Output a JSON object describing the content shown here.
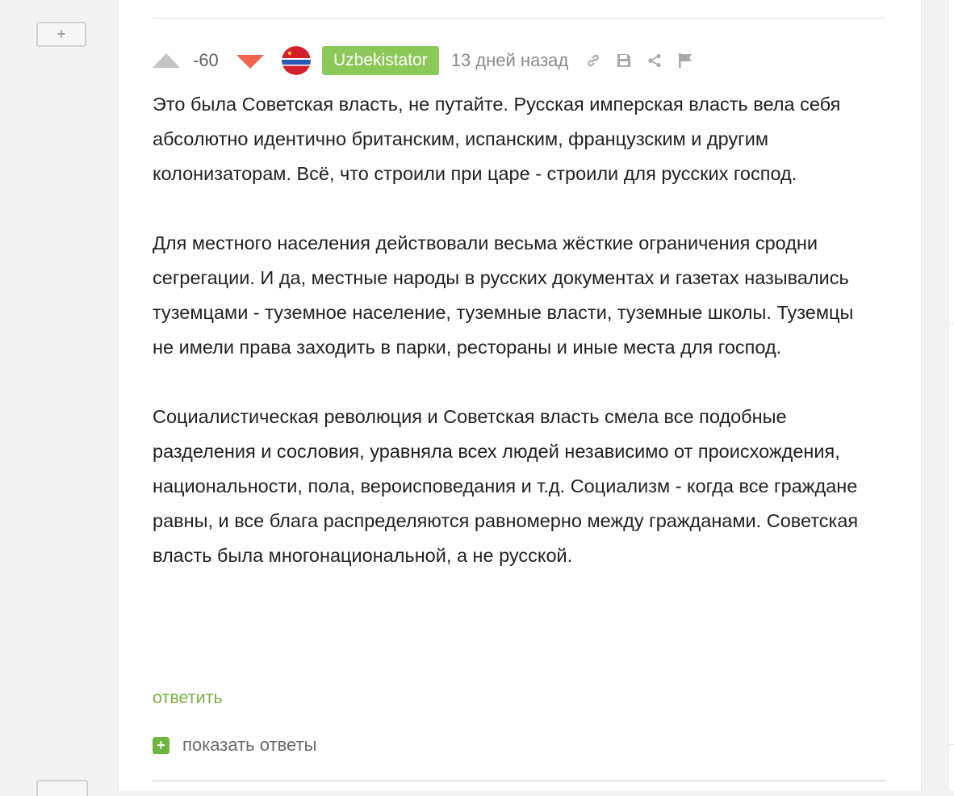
{
  "sidebar": {
    "collapse_label": "+"
  },
  "comment": {
    "rating": "-60",
    "username": "Uzbekistator",
    "timestamp": "13 дней назад",
    "actions": [
      "link-icon",
      "save-icon",
      "share-icon",
      "flag-icon"
    ],
    "paragraphs": [
      "Это была Советская власть, не путайте. Русская имперская власть вела себя абсолютно идентично британским, испанским, французским и другим колонизаторам. Всё, что строили при царе - строили для русских господ.",
      "Для местного населения действовали весьма жёсткие ограничения сродни сегрегации. И да, местные народы в русских документах и газетах назывались туземцами - туземное население, туземные власти, туземные школы. Туземцы не имели права заходить в парки, рестораны и иные места для господ.",
      "Социалистическая революция и Советская власть смела все подобные разделения и сословия, уравняла всех людей независимо от происхождения, национальности, пола, вероисповедания и т.д. Социализм - когда все граждане равны, и все блага распределяются равномерно между гражданами. Советская власть была многонациональной, а не русской."
    ],
    "reply_label": "ответить",
    "show_replies_label": "показать ответы",
    "show_replies_icon": "+"
  },
  "colors": {
    "username_bg": "#8ac858",
    "vote_down": "#f0644a",
    "vote_up": "#c4c4c4",
    "link": "#7ab342",
    "text": "#222222"
  }
}
